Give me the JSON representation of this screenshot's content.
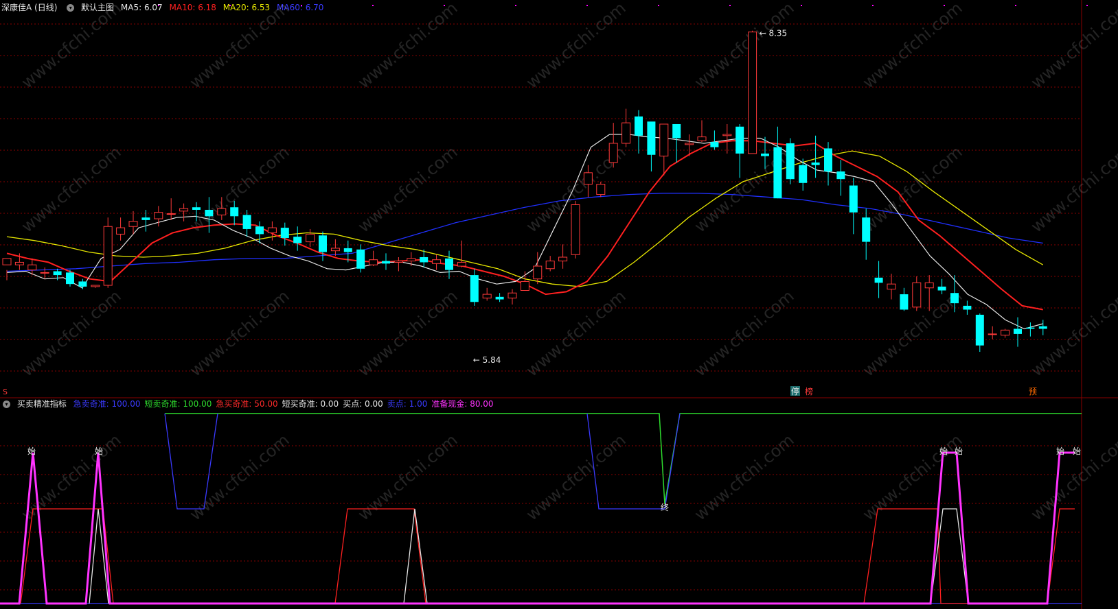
{
  "main_header": {
    "stock": "深康佳A (日线)",
    "chart_name": "默认主图",
    "ma5": "MA5: 6.07",
    "ma10": "MA10: 6.18",
    "ma20": "MA20: 6.53",
    "ma60": "MA60: 6.70"
  },
  "main_labels": {
    "high_label": "8.35",
    "low_label": "5.84",
    "left_marker": "S",
    "stop_marker": "停",
    "list_marker": "榜",
    "pre_marker": "预"
  },
  "sub_header": {
    "indicator_name": "买卖精准指标",
    "fields": [
      {
        "text": "急卖奇准: 100.00",
        "color": "#3a3aff"
      },
      {
        "text": "短卖奇准: 100.00",
        "color": "#2edb2e"
      },
      {
        "text": "急买奇准: 50.00",
        "color": "#ff2a2a"
      },
      {
        "text": "短买奇准: 0.00",
        "color": "#e6e6e6"
      },
      {
        "text": "买点: 0.00",
        "color": "#e6e6e6"
      },
      {
        "text": "卖点: 1.00",
        "color": "#3a3aff"
      },
      {
        "text": "准备现金: 80.00",
        "color": "#ff33ff"
      }
    ]
  },
  "sub_labels": {
    "start": "始",
    "end": "终"
  },
  "watermark": "www.cfchi.com",
  "colors": {
    "up": "#ff3a3a",
    "down": "#00ffff",
    "ma5": "#e6e6e6",
    "ma10": "#ff2020",
    "ma20": "#e8e800",
    "ma60": "#2030ff",
    "grid": "#8a0000"
  },
  "chart_data": {
    "type": "candlestick",
    "y_range": [
      5.55,
      8.45
    ],
    "candles": [
      [
        6.53,
        6.58,
        6.49,
        6.41
      ],
      [
        6.53,
        6.55,
        6.62,
        6.49
      ],
      [
        6.49,
        6.53,
        6.58,
        6.45
      ],
      [
        6.47,
        6.47,
        6.51,
        6.42
      ],
      [
        6.48,
        6.45,
        6.5,
        6.41
      ],
      [
        6.47,
        6.38,
        6.49,
        6.36
      ],
      [
        6.4,
        6.36,
        6.42,
        6.34
      ],
      [
        6.36,
        6.37,
        6.37,
        6.35
      ],
      [
        6.37,
        6.83,
        6.9,
        6.35
      ],
      [
        6.77,
        6.82,
        6.9,
        6.72
      ],
      [
        6.83,
        6.87,
        6.95,
        6.77
      ],
      [
        6.9,
        6.88,
        6.96,
        6.79
      ],
      [
        6.89,
        6.94,
        6.99,
        6.83
      ],
      [
        6.93,
        6.93,
        7.05,
        6.88
      ],
      [
        6.95,
        6.97,
        7.01,
        6.87
      ],
      [
        6.98,
        6.96,
        7.02,
        6.87
      ],
      [
        6.96,
        6.91,
        7.06,
        6.78
      ],
      [
        6.92,
        6.97,
        7.06,
        6.88
      ],
      [
        6.98,
        6.91,
        7.03,
        6.84
      ],
      [
        6.92,
        6.81,
        6.96,
        6.75
      ],
      [
        6.83,
        6.77,
        6.87,
        6.7
      ],
      [
        6.78,
        6.82,
        6.87,
        6.72
      ],
      [
        6.82,
        6.74,
        6.86,
        6.68
      ],
      [
        6.75,
        6.7,
        6.83,
        6.64
      ],
      [
        6.71,
        6.77,
        6.81,
        6.67
      ],
      [
        6.76,
        6.63,
        6.79,
        6.56
      ],
      [
        6.64,
        6.66,
        6.73,
        6.6
      ],
      [
        6.66,
        6.63,
        6.72,
        6.55
      ],
      [
        6.65,
        6.5,
        6.69,
        6.47
      ],
      [
        6.53,
        6.57,
        6.64,
        6.52
      ],
      [
        6.56,
        6.54,
        6.62,
        6.49
      ],
      [
        6.55,
        6.56,
        6.59,
        6.48
      ],
      [
        6.56,
        6.58,
        6.63,
        6.52
      ],
      [
        6.59,
        6.55,
        6.65,
        6.51
      ],
      [
        6.54,
        6.57,
        6.61,
        6.49
      ],
      [
        6.58,
        6.49,
        6.64,
        6.42
      ],
      [
        6.52,
        6.55,
        6.72,
        6.51
      ],
      [
        6.45,
        6.24,
        6.5,
        6.21
      ],
      [
        6.27,
        6.3,
        6.35,
        6.25
      ],
      [
        6.28,
        6.26,
        6.31,
        6.24
      ],
      [
        6.27,
        6.31,
        6.34,
        6.22
      ],
      [
        6.33,
        6.4,
        6.48,
        6.35
      ],
      [
        6.42,
        6.52,
        6.63,
        6.38
      ],
      [
        6.5,
        6.56,
        6.6,
        6.48
      ],
      [
        6.56,
        6.59,
        6.69,
        6.5
      ],
      [
        6.61,
        7.0,
        7.03,
        6.58
      ],
      [
        7.16,
        7.25,
        7.31,
        7.06
      ],
      [
        7.08,
        7.16,
        7.18,
        7.06
      ],
      [
        7.33,
        7.48,
        7.64,
        7.29
      ],
      [
        7.48,
        7.64,
        7.75,
        7.45
      ],
      [
        7.69,
        7.54,
        7.74,
        7.4
      ],
      [
        7.65,
        7.39,
        7.56,
        7.26
      ],
      [
        7.38,
        7.63,
        7.63,
        7.23
      ],
      [
        7.63,
        7.52,
        7.58,
        7.33
      ],
      [
        7.47,
        7.48,
        7.55,
        7.38
      ],
      [
        7.5,
        7.53,
        7.66,
        7.49
      ],
      [
        7.49,
        7.45,
        7.58,
        7.43
      ],
      [
        7.54,
        7.55,
        7.63,
        7.4
      ],
      [
        7.61,
        7.4,
        7.63,
        7.21
      ],
      [
        7.4,
        8.35,
        8.36,
        7.4
      ],
      [
        7.4,
        7.38,
        7.53,
        7.28
      ],
      [
        7.45,
        7.05,
        7.61,
        7.05
      ],
      [
        7.48,
        7.2,
        7.52,
        7.16
      ],
      [
        7.31,
        7.17,
        7.36,
        7.11
      ],
      [
        7.33,
        7.31,
        7.54,
        7.21
      ],
      [
        7.44,
        7.26,
        7.49,
        7.15
      ],
      [
        7.26,
        7.2,
        7.35,
        7.07
      ],
      [
        7.15,
        6.94,
        7.21,
        6.77
      ],
      [
        6.9,
        6.71,
        6.97,
        6.57
      ],
      [
        6.43,
        6.39,
        6.56,
        6.27
      ],
      [
        6.34,
        6.38,
        6.46,
        6.26
      ],
      [
        6.3,
        6.18,
        6.35,
        6.17
      ],
      [
        6.2,
        6.39,
        6.44,
        6.17
      ],
      [
        6.35,
        6.39,
        6.45,
        6.17
      ],
      [
        6.36,
        6.33,
        6.42,
        6.3
      ],
      [
        6.31,
        6.23,
        6.45,
        6.16
      ],
      [
        6.21,
        6.18,
        6.25,
        6.14
      ],
      [
        6.14,
        5.9,
        6.15,
        5.85
      ],
      [
        5.99,
        5.99,
        6.05,
        5.95
      ],
      [
        5.98,
        6.02,
        6.03,
        5.96
      ],
      [
        6.03,
        5.99,
        6.12,
        5.89
      ],
      [
        6.04,
        6.03,
        6.08,
        5.97
      ],
      [
        6.05,
        6.03,
        6.1,
        5.98
      ]
    ],
    "ma_lines": {
      "ma5": [
        [
          6.47,
          6.48
        ],
        [
          6.42,
          6.43
        ],
        [
          6.35,
          6.58
        ],
        [
          6.65,
          6.82
        ],
        [
          6.86,
          6.9
        ],
        [
          6.91,
          6.88
        ],
        [
          6.8,
          6.74
        ],
        [
          6.66,
          6.6
        ],
        [
          6.56,
          6.5
        ],
        [
          6.49,
          6.52
        ],
        [
          6.55,
          6.55
        ],
        [
          6.52,
          6.47
        ],
        [
          6.48,
          6.42
        ],
        [
          6.38,
          6.4
        ],
        [
          6.5,
          6.8
        ],
        [
          7.1,
          7.45
        ],
        [
          7.55,
          7.55
        ],
        [
          7.53,
          7.52
        ],
        [
          7.5,
          7.48
        ],
        [
          7.5,
          7.52
        ],
        [
          7.52,
          7.45
        ],
        [
          7.35,
          7.27
        ],
        [
          7.25,
          7.22
        ],
        [
          7.18,
          7.0
        ],
        [
          6.8,
          6.6
        ],
        [
          6.46,
          6.3
        ],
        [
          6.22,
          6.1
        ],
        [
          6.03,
          6.07
        ]
      ],
      "ma10": [
        [
          6.62,
          6.58
        ],
        [
          6.55,
          6.48
        ],
        [
          6.42,
          6.4
        ],
        [
          6.55,
          6.7
        ],
        [
          6.78,
          6.82
        ],
        [
          6.84,
          6.85
        ],
        [
          6.84,
          6.76
        ],
        [
          6.7,
          6.63
        ],
        [
          6.58,
          6.56
        ],
        [
          6.55,
          6.56
        ],
        [
          6.57,
          6.54
        ],
        [
          6.52,
          6.48
        ],
        [
          6.44,
          6.38
        ],
        [
          6.3,
          6.32
        ],
        [
          6.4,
          6.6
        ],
        [
          6.85,
          7.1
        ],
        [
          7.3,
          7.4
        ],
        [
          7.48,
          7.5
        ],
        [
          7.5,
          7.48
        ],
        [
          7.46,
          7.48
        ],
        [
          7.38,
          7.3
        ],
        [
          7.22,
          7.1
        ],
        [
          6.88,
          6.76
        ],
        [
          6.62,
          6.48
        ],
        [
          6.34,
          6.21
        ],
        [
          6.18
        ]
      ],
      "ma20": [
        [
          6.75,
          6.72
        ],
        [
          6.68,
          6.63
        ],
        [
          6.6,
          6.59
        ],
        [
          6.6,
          6.62
        ],
        [
          6.66,
          6.72
        ],
        [
          6.76,
          6.78
        ],
        [
          6.77,
          6.72
        ],
        [
          6.68,
          6.65
        ],
        [
          6.6,
          6.55
        ],
        [
          6.5,
          6.42
        ],
        [
          6.38,
          6.36
        ],
        [
          6.4,
          6.55
        ],
        [
          6.72,
          6.9
        ],
        [
          7.05,
          7.18
        ],
        [
          7.25,
          7.32
        ],
        [
          7.38,
          7.42
        ],
        [
          7.38,
          7.26
        ],
        [
          7.1,
          6.95
        ],
        [
          6.8,
          6.65
        ],
        [
          6.53
        ]
      ],
      "ma60": [
        [
          6.48,
          6.49
        ],
        [
          6.5,
          6.52
        ],
        [
          6.54,
          6.55
        ],
        [
          6.57,
          6.58
        ],
        [
          6.58,
          6.6
        ],
        [
          6.62,
          6.7
        ],
        [
          6.78,
          6.86
        ],
        [
          6.92,
          6.98
        ],
        [
          7.03,
          7.06
        ],
        [
          7.08,
          7.09
        ],
        [
          7.09,
          7.08
        ],
        [
          7.06,
          7.04
        ],
        [
          7.0,
          6.97
        ],
        [
          6.92,
          6.86
        ],
        [
          6.8,
          6.74
        ],
        [
          6.7
        ]
      ]
    }
  }
}
